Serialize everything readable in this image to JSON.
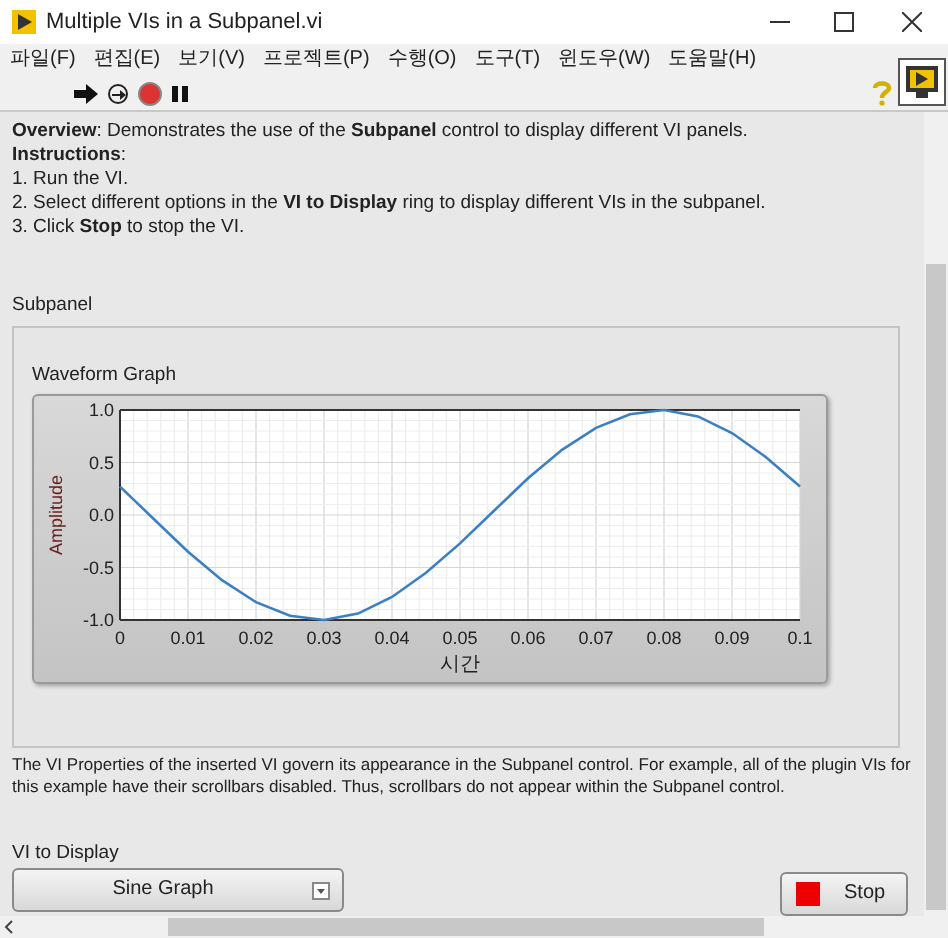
{
  "window": {
    "title": "Multiple VIs in a Subpanel.vi"
  },
  "menu": [
    "파일(F)",
    "편집(E)",
    "보기(V)",
    "프로젝트(P)",
    "수행(O)",
    "도구(T)",
    "윈도우(W)",
    "도움말(H)"
  ],
  "description": {
    "overview": "**Overview**: Demonstrates the use of the **Subpanel** control to display different VI panels.",
    "heading": "**Instructions**:",
    "steps": [
      "1. Run the VI.",
      "2. Select different options in the **VI to Display** ring to display different VIs in the subpanel.",
      "3. Click **Stop** to stop the VI."
    ]
  },
  "subpanel": {
    "label": "Subpanel",
    "graph": {
      "label": "Waveform Graph",
      "chart_data": {
        "type": "line",
        "xlabel": "시간",
        "ylabel": "Amplitude",
        "x": [
          0,
          0.005,
          0.01,
          0.015,
          0.02,
          0.025,
          0.03,
          0.035,
          0.04,
          0.045,
          0.05,
          0.055,
          0.06,
          0.065,
          0.07,
          0.075,
          0.08,
          0.085,
          0.09,
          0.095,
          0.1
        ],
        "series": [
          {
            "color": "#3b7fc4",
            "values": [
              0.27,
              -0.04,
              -0.35,
              -0.62,
              -0.83,
              -0.96,
              -1.0,
              -0.94,
              -0.78,
              -0.55,
              -0.27,
              0.04,
              0.35,
              0.62,
              0.83,
              0.96,
              1.0,
              0.94,
              0.78,
              0.55,
              0.27
            ]
          }
        ],
        "grid": true,
        "xlim": [
          0,
          0.1
        ],
        "ylim": [
          -1,
          1
        ],
        "xticks": [
          {
            "value": 0,
            "label": "0"
          },
          {
            "value": 0.01,
            "label": "0.01"
          },
          {
            "value": 0.02,
            "label": "0.02"
          },
          {
            "value": 0.03,
            "label": "0.03"
          },
          {
            "value": 0.04,
            "label": "0.04"
          },
          {
            "value": 0.05,
            "label": "0.05"
          },
          {
            "value": 0.06,
            "label": "0.06"
          },
          {
            "value": 0.07,
            "label": "0.07"
          },
          {
            "value": 0.08,
            "label": "0.08"
          },
          {
            "value": 0.09,
            "label": "0.09"
          },
          {
            "value": 0.1,
            "label": "0.1"
          }
        ],
        "yticks": [
          {
            "value": 1,
            "label": "1.0"
          },
          {
            "value": 0.5,
            "label": "0.5"
          },
          {
            "value": 0,
            "label": "0.0"
          },
          {
            "value": -0.5,
            "label": "-0.5"
          },
          {
            "value": -1,
            "label": "-1.0"
          }
        ]
      }
    }
  },
  "note": "The VI Properties of the inserted VI govern its appearance in the Subpanel control. For example, all of the plugin VIs for this example have their scrollbars disabled. Thus, scrollbars do not appear within the Subpanel control.",
  "vi_to_display": {
    "label": "VI to Display",
    "value": "Sine Graph"
  },
  "stop_button": {
    "label": "Stop"
  }
}
